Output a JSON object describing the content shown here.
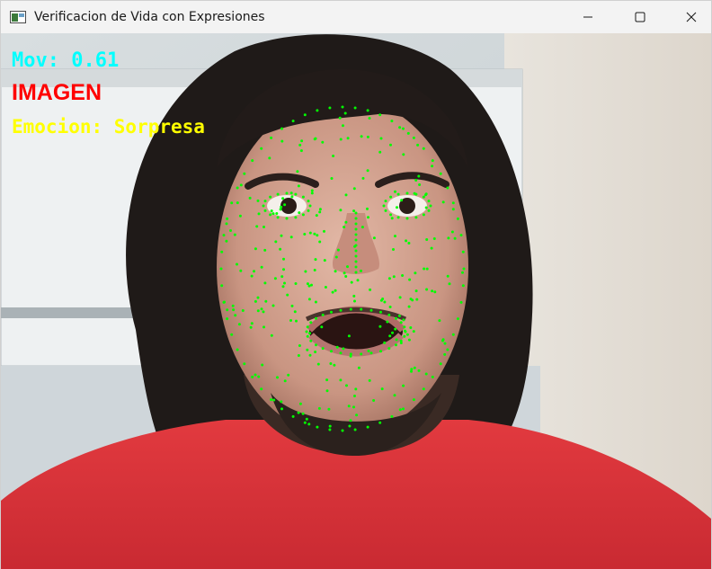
{
  "window": {
    "title": "Verificacion de Vida con Expresiones",
    "controls": [
      "minimize",
      "maximize",
      "close"
    ]
  },
  "overlay": {
    "movement_label": "Mov: 0.61",
    "status_label": "IMAGEN",
    "emotion_label": "Emocion: Sorpresa"
  },
  "colors": {
    "movement": "#00ffff",
    "status": "#ff0000",
    "emotion": "#ffff00",
    "landmarks": "#00ff00",
    "titlebar": "#f3f3f3"
  },
  "icons": {
    "app": "app-window-icon",
    "minimize": "minimize-icon",
    "maximize": "maximize-icon",
    "close": "close-icon"
  }
}
